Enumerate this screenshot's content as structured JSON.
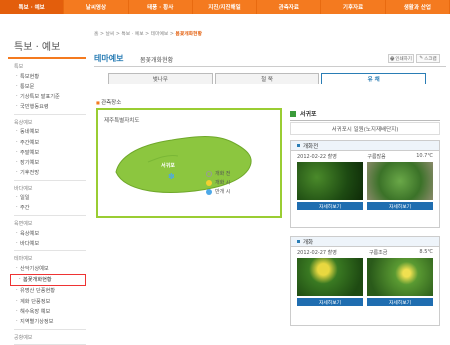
{
  "nav": [
    "특보 · 예보",
    "날씨영상",
    "태풍 · 황사",
    "지진/지진해일",
    "관측자료",
    "기후자료",
    "생활과 산업"
  ],
  "sidebar": {
    "title": "특보 · 예보",
    "groups": [
      {
        "head": "특보",
        "items": [
          "특보현황",
          "통보문",
          "기상특보 발표기준",
          "국민행동요령"
        ]
      },
      {
        "head": "육상예보",
        "items": [
          "동네예보",
          "주간예보",
          "주말예보",
          "장기예보",
          "기후전망"
        ]
      },
      {
        "head": "바다예보",
        "items": [
          "일일",
          "주간"
        ]
      },
      {
        "head": "육면예보",
        "items": [
          "육상예보",
          "바다예보"
        ]
      },
      {
        "head": "테마예보",
        "items": [
          "산악기상예보",
          "봄꽃개화현황",
          "유명산 단풍현황",
          "계화 단풍정보",
          "해수욕장 예보",
          "지역별기상정보"
        ]
      },
      {
        "head": "공항예보",
        "items": []
      }
    ],
    "active_item": "봄꽃개화현황"
  },
  "breadcrumb": {
    "path": "홈 > 날씨 > 특보 · 예보 > 테마예보 > ",
    "current": "봄꽃개화현황"
  },
  "title": {
    "main": "테마예보",
    "sub": "봄꽃개화현황",
    "print": "인쇄하기",
    "scrap": "스크랩"
  },
  "tabs": [
    "벚나무",
    "철 쭉",
    "유 채"
  ],
  "active_tab": "유 채",
  "map": {
    "label": "관측장소",
    "region": "제주특별자치도",
    "city": "서귀포"
  },
  "legend": [
    {
      "label": "개화 전",
      "icon": "flower-outline-icon",
      "color": "#ffffff"
    },
    {
      "label": "개화 시",
      "icon": "flower-half-icon",
      "color": "#f4d030"
    },
    {
      "label": "만개 시",
      "icon": "flower-full-icon",
      "color": "#4da8e8"
    }
  ],
  "right": {
    "heading": "서귀포",
    "station": "서귀포시 일원(노지재배단지)"
  },
  "panels": [
    {
      "title": "개화전",
      "date": "2012-02-22 촬영",
      "weather": "구름많음",
      "temp": "10.7℃",
      "btn": "자세히보기"
    },
    {
      "title": "개화",
      "date": "2012-02-27 촬영",
      "weather": "구름조금",
      "temp": "8.5℃",
      "btn": "자세히보기"
    }
  ]
}
